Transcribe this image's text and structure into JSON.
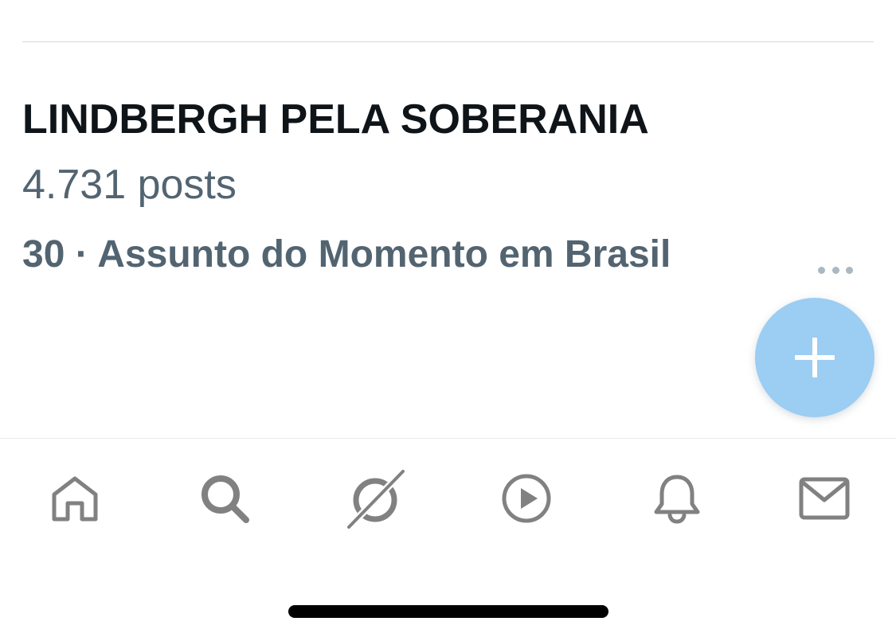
{
  "trend": {
    "title": "LINDBERGH PELA SOBERANIA",
    "count": "4.731 posts",
    "meta": "30 · Assunto do Momento em Brasil"
  },
  "icons": {
    "more": "more-horizontal-icon",
    "compose": "plus-icon",
    "tabs": [
      "home-icon",
      "search-icon",
      "grok-icon",
      "play-icon",
      "bell-icon",
      "mail-icon"
    ]
  },
  "colors": {
    "primary_text": "#0f1419",
    "secondary_text": "#536471",
    "fab": "#9ccdf3",
    "icon": "#818181"
  }
}
